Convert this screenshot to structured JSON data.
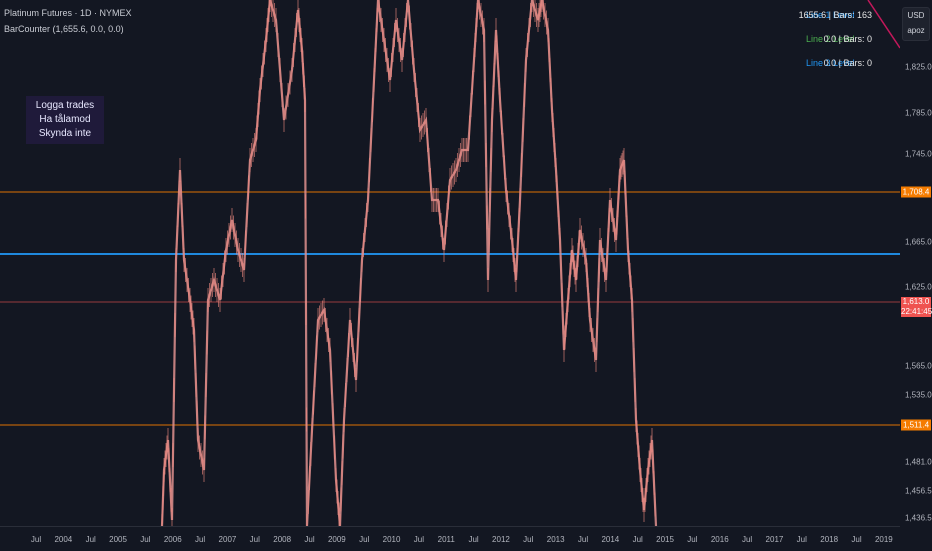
{
  "header": {
    "title": "Platinum Futures · 1D · NYMEX",
    "indicator": "BarCounter (1,655.6, 0.0, 0.0)"
  },
  "notes": [
    "Logga trades",
    "Ha tålamod",
    "Skynda inte"
  ],
  "levels_table": [
    {
      "name": "Line 1 Level",
      "value": "1655.6 | Bars: 163",
      "color": "#2196f3"
    },
    {
      "name": "Line 2 Level",
      "value": "0.0 | Bars: 0",
      "color": "#4caf50"
    },
    {
      "name": "Line 3 Level",
      "value": "0.0 | Bars: 0",
      "color": "#2196f3"
    }
  ],
  "currency": {
    "code": "USD",
    "unit": "apoz"
  },
  "price_axis": {
    "ticks": [
      "1,825.0",
      "1,785.0",
      "1,745.0",
      "1,665.0",
      "1,625.0",
      "1,565.0",
      "1,535.0",
      "1,481.0",
      "1,456.5",
      "1,436.5"
    ],
    "labels": [
      {
        "text": "1,708.4",
        "color": "#f57c00"
      },
      {
        "text": "1,613.0",
        "sub": "22:41:45",
        "color": "#ef5350"
      },
      {
        "text": "1,511.4",
        "color": "#f57c00"
      }
    ]
  },
  "time_axis": [
    "Jul",
    "2004",
    "Jul",
    "2005",
    "Jul",
    "2006",
    "Jul",
    "2007",
    "Jul",
    "2008",
    "Jul",
    "2009",
    "Jul",
    "2010",
    "Jul",
    "2011",
    "Jul",
    "2012",
    "Jul",
    "2013",
    "Jul",
    "2014",
    "Jul",
    "2015",
    "Jul",
    "2016",
    "Jul",
    "2017",
    "Jul",
    "2018",
    "Jul",
    "2019",
    "Jul"
  ],
  "chart_data": {
    "type": "line",
    "title": "Platinum Futures · 1D · NYMEX",
    "series_color": "#e0908e",
    "horizontal_levels": [
      {
        "value": 1708.4,
        "color": "#f57c00"
      },
      {
        "value": 1655.6,
        "color": "#2196f3"
      },
      {
        "value": 1613.0,
        "color": "#ef5350"
      },
      {
        "value": 1511.4,
        "color": "#f57c00"
      }
    ],
    "x_range": [
      "2003-07",
      "2019-07"
    ],
    "y_range": [
      1436.5,
      1865
    ]
  }
}
